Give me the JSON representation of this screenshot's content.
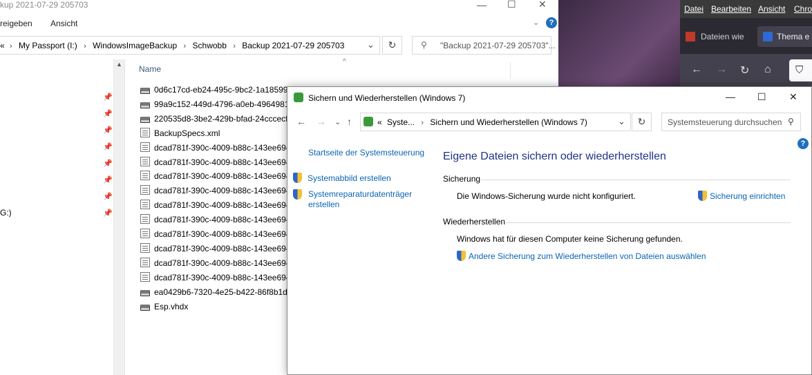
{
  "explorer": {
    "title": "kup 2021-07-29 205703",
    "ribbon": {
      "tab_share": "reigeben",
      "tab_view": "Ansicht"
    },
    "breadcrumb": {
      "prefix": "«",
      "items": [
        "My Passport (I:)",
        "WindowsImageBackup",
        "Schwobb",
        "Backup 2021-07-29 205703"
      ]
    },
    "search_placeholder": "\"Backup 2021-07-29 205703\"...",
    "nav_partial_item": "G:)",
    "column_name": "Name",
    "files": [
      {
        "name": "0d6c17cd-eb24-495c-9bc2-1a185995",
        "icon": "drive-icon"
      },
      {
        "name": "99a9c152-449d-4796-a0eb-496498154",
        "icon": "drive-icon"
      },
      {
        "name": "220535d8-3be2-429b-bfad-24cccecfe",
        "icon": "drive-icon"
      },
      {
        "name": "BackupSpecs.xml",
        "icon": "document-icon"
      },
      {
        "name": "dcad781f-390c-4009-b88c-143ee694c",
        "icon": "document-icon"
      },
      {
        "name": "dcad781f-390c-4009-b88c-143ee694c",
        "icon": "document-icon"
      },
      {
        "name": "dcad781f-390c-4009-b88c-143ee694c",
        "icon": "document-icon"
      },
      {
        "name": "dcad781f-390c-4009-b88c-143ee694c",
        "icon": "document-icon"
      },
      {
        "name": "dcad781f-390c-4009-b88c-143ee694c",
        "icon": "document-icon"
      },
      {
        "name": "dcad781f-390c-4009-b88c-143ee694c",
        "icon": "document-icon"
      },
      {
        "name": "dcad781f-390c-4009-b88c-143ee694c",
        "icon": "document-icon"
      },
      {
        "name": "dcad781f-390c-4009-b88c-143ee694c",
        "icon": "document-icon"
      },
      {
        "name": "dcad781f-390c-4009-b88c-143ee694c",
        "icon": "document-icon"
      },
      {
        "name": "dcad781f-390c-4009-b88c-143ee694c",
        "icon": "document-icon"
      },
      {
        "name": "ea0429b6-7320-4e25-b422-86f8b1d57",
        "icon": "drive-icon"
      },
      {
        "name": "Esp.vhdx",
        "icon": "drive-icon"
      }
    ]
  },
  "browser": {
    "menu": [
      "Datei",
      "Bearbeiten",
      "Ansicht",
      "Chro"
    ],
    "tabs": [
      "Dateien wie",
      "Thema e"
    ]
  },
  "control_panel": {
    "window_title": "Sichern und Wiederherstellen (Windows 7)",
    "address": {
      "prefix": "«",
      "items": [
        "Syste...",
        "Sichern und Wiederherstellen (Windows 7)"
      ]
    },
    "search_placeholder": "Systemsteuerung durchsuchen",
    "sidebar": {
      "home_link": "Startseite der Systemsteuerung",
      "links": [
        "Systemabbild erstellen",
        "Systemreparaturdatenträger erstellen"
      ]
    },
    "heading": "Eigene Dateien sichern oder wiederherstellen",
    "backup": {
      "label": "Sicherung",
      "status": "Die Windows-Sicherung wurde nicht konfiguriert.",
      "action": "Sicherung einrichten"
    },
    "restore": {
      "label": "Wiederherstellen",
      "status": "Windows hat für diesen Computer keine Sicherung gefunden.",
      "action": "Andere Sicherung zum Wiederherstellen von Dateien auswählen"
    },
    "help": "?"
  },
  "colors": {
    "link": "#0a64b4",
    "heading": "#1e3287",
    "help_badge": "#1f6fbf"
  }
}
